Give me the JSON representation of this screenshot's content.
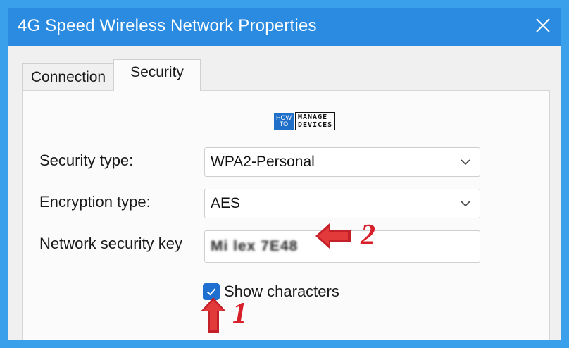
{
  "window": {
    "title": "4G Speed Wireless Network Properties",
    "close_glyph": "✕"
  },
  "tabs": [
    {
      "label": "Connection",
      "selected": false
    },
    {
      "label": "Security",
      "selected": true
    }
  ],
  "logo": {
    "how": "HOW",
    "to": "TO",
    "manage": "MANAGE",
    "devices": "DEVICES"
  },
  "form": {
    "security_type": {
      "label": "Security type:",
      "value": "WPA2-Personal"
    },
    "encryption_type": {
      "label": "Encryption type:",
      "value": "AES"
    },
    "network_key": {
      "label": "Network security key",
      "value": "Mi lex 7E48"
    },
    "show_characters": {
      "label": "Show characters",
      "checked": true
    }
  },
  "annotations": {
    "step1": "1",
    "step2": "2",
    "color": "#d8202a"
  },
  "colors": {
    "titlebar": "#2b8be0",
    "frame": "#3aa0ec",
    "checkbox": "#1e6fcf"
  },
  "icons": [
    "close-icon",
    "chevron-down-icon",
    "checkmark-icon",
    "arrow-left-icon",
    "arrow-up-icon"
  ]
}
